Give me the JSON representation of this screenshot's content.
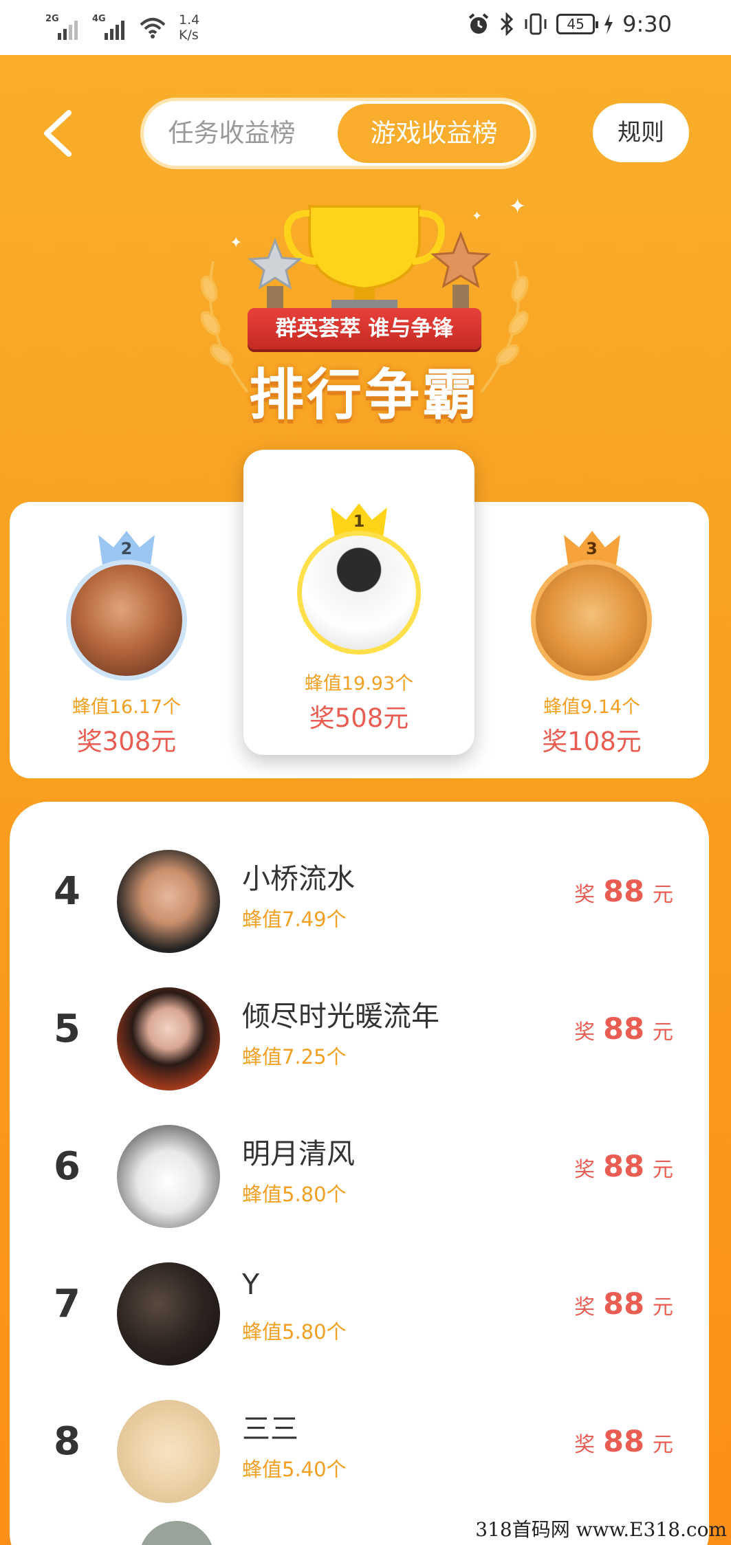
{
  "status_bar": {
    "net1": "2G",
    "net2": "4G",
    "speed_value": "1.4",
    "speed_unit": "K/s",
    "battery": "45",
    "time": "9:30"
  },
  "header": {
    "back_icon": "chevron-left-icon",
    "tabs": [
      {
        "label": "任务收益榜",
        "active": false
      },
      {
        "label": "游戏收益榜",
        "active": true
      }
    ],
    "rules_label": "规则"
  },
  "banner": {
    "ribbon_text": "群英荟萃 谁与争锋",
    "title": "排行争霸"
  },
  "podium": [
    {
      "rank": "2",
      "score": "蜂值16.17个",
      "prize": "奖308元",
      "crown_color": "#9cc6f2",
      "ring_color": "#cfe3f7"
    },
    {
      "rank": "1",
      "score": "蜂值19.93个",
      "prize": "奖508元",
      "crown_color": "#ffd318",
      "ring_color": "#ffe04a"
    },
    {
      "rank": "3",
      "score": "蜂值9.14个",
      "prize": "奖108元",
      "crown_color": "#f5a33a",
      "ring_color": "#f7b45a"
    }
  ],
  "list": [
    {
      "rank": "4",
      "name": "小桥流水",
      "score": "蜂值7.49个",
      "prize_prefix": "奖",
      "prize_amount": "88",
      "prize_unit": "元"
    },
    {
      "rank": "5",
      "name": "倾尽时光暖流年",
      "score": "蜂值7.25个",
      "prize_prefix": "奖",
      "prize_amount": "88",
      "prize_unit": "元"
    },
    {
      "rank": "6",
      "name": "明月清风",
      "score": "蜂值5.80个",
      "prize_prefix": "奖",
      "prize_amount": "88",
      "prize_unit": "元"
    },
    {
      "rank": "7",
      "name": "Y",
      "score": "蜂值5.80个",
      "prize_prefix": "奖",
      "prize_amount": "88",
      "prize_unit": "元"
    },
    {
      "rank": "8",
      "name": "三三",
      "score": "蜂值5.40个",
      "prize_prefix": "奖",
      "prize_amount": "88",
      "prize_unit": "元"
    }
  ],
  "watermark": "318首码网 www.E318.com",
  "colors": {
    "accent": "#f8ad2c",
    "prize": "#ea5d52",
    "score": "#f3a022"
  }
}
